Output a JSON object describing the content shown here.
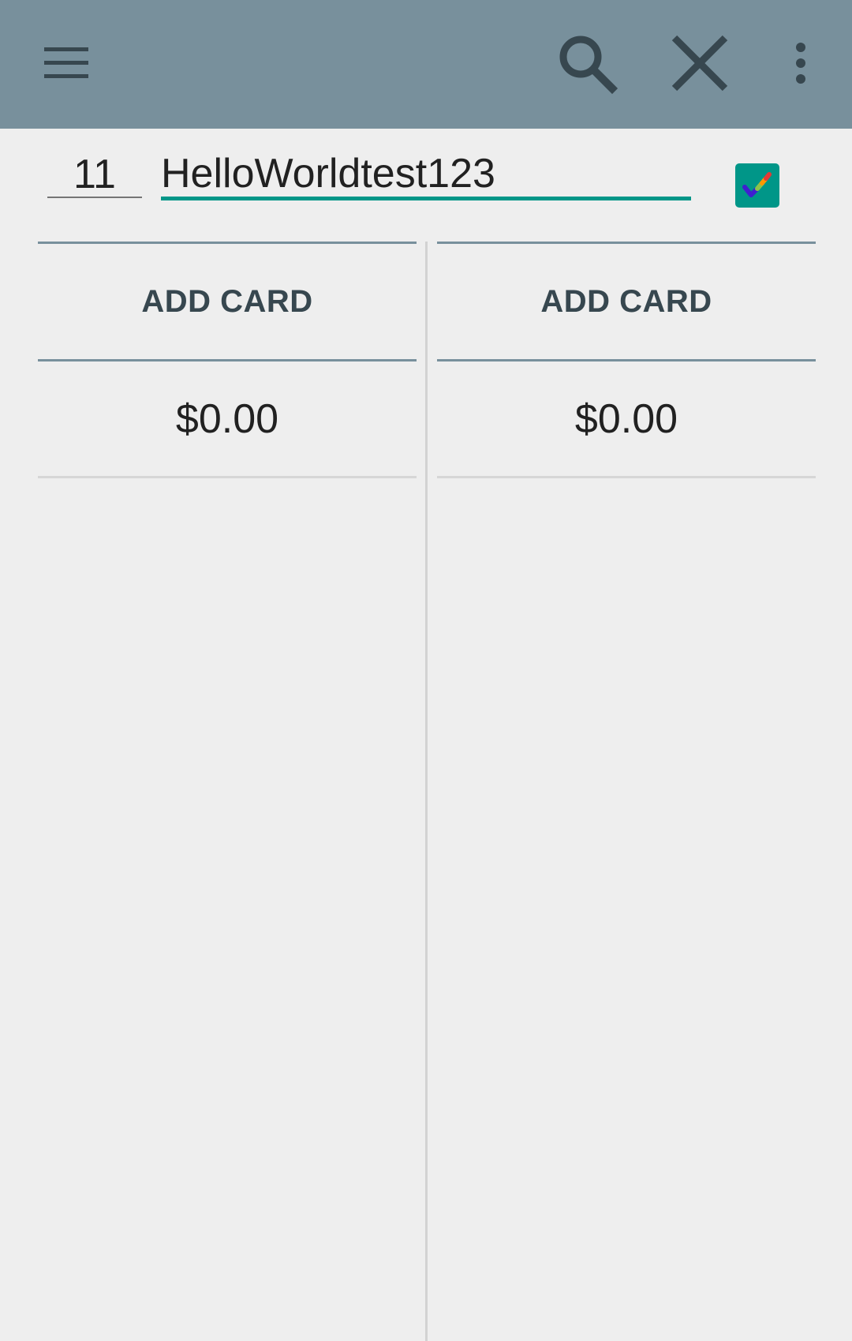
{
  "toolbar": {
    "menu_icon": "menu-icon",
    "search_icon": "search-icon",
    "close_icon": "close-icon",
    "more_icon": "more-vert-icon",
    "background_color": "#78909c",
    "icon_color": "#37474f"
  },
  "editor": {
    "number_value": "11",
    "title_value": "HelloWorldtest123",
    "accent_color": "#009688",
    "edit_toggle_icon": "pen-check-icon"
  },
  "columns": [
    {
      "add_card_label": "ADD CARD",
      "total": "$0.00"
    },
    {
      "add_card_label": "ADD CARD",
      "total": "$0.00"
    }
  ]
}
